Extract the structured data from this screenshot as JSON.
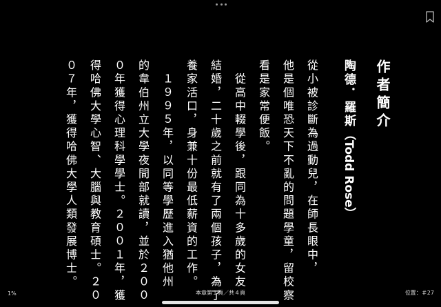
{
  "window": {
    "more_icon": "ellipsis-icon",
    "bookmark_icon": "bookmark-icon"
  },
  "content": {
    "title": "作者簡介",
    "author_cjk": "陶德．羅斯",
    "author_latin": "（Todd Rose）",
    "lines": [
      "從小被診斷為過動兒，在師長眼中，",
      "他是個唯恐天下不亂的問題學童，留校察",
      "看是家常便飯。",
      "　從高中輟學後，跟同為十多歲的女友",
      "結婚，二十歲之前就有了兩個孩子，為了",
      "養家活口，身兼十份最低薪資的工作。",
      "　１９９５年，以同等學歷進入猶他州",
      "的韋伯州立大學夜間部就讀，並於２００",
      "０年獲得心理科學學士。２００１年，獲",
      "得哈佛大學心智、大腦與教育碩士。２０",
      "０７年，獲得哈佛大學人類發展博士。"
    ]
  },
  "footer": {
    "progress_percent": "1%",
    "chapter_pages": "本章第１頁／共４頁",
    "location": "位置：＃27"
  }
}
